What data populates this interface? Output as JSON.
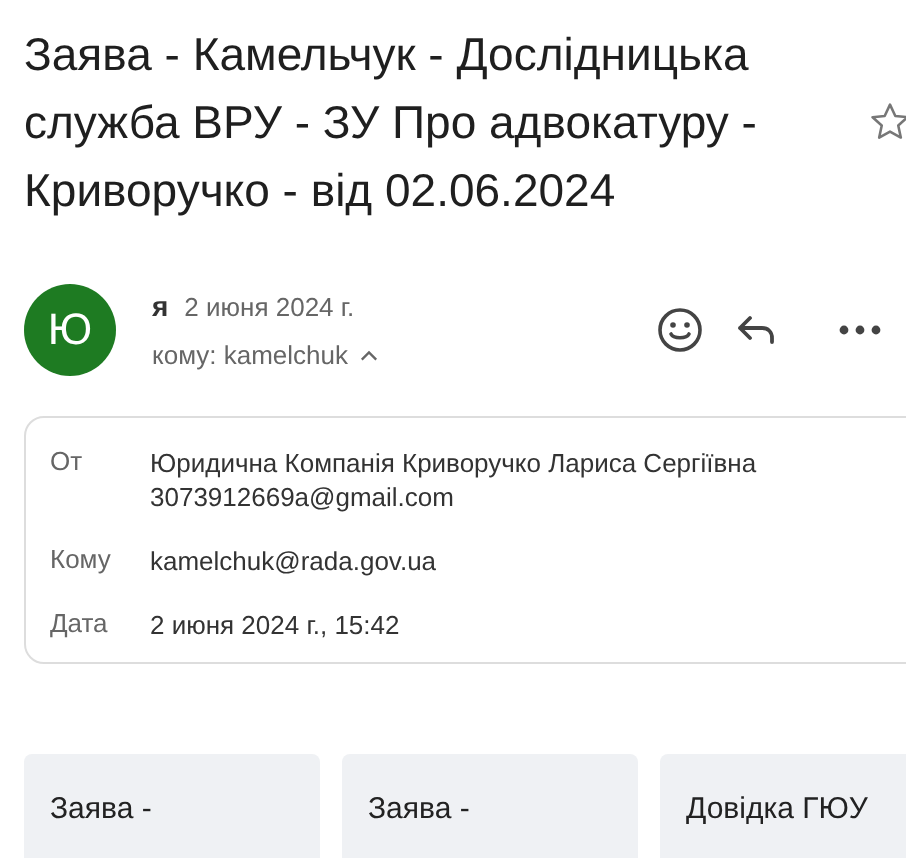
{
  "subject": "Заява - Камельчук - Дослідницька служба ВРУ - ЗУ Про адвокатуру - Криворучко - від 02.06.2024",
  "message": {
    "avatar_letter": "Ю",
    "sender": "я",
    "date": "2 июня 2024 г.",
    "to": "кому: kamelchuk",
    "details_expanded": true
  },
  "details": [
    {
      "label": "От",
      "lines": [
        "Юридична Компанія Криворучко Лариса Сергіївна",
        "3073912669a@gmail.com"
      ]
    },
    {
      "label": "Кому",
      "lines": [
        "kamelchuk@rada.gov.ua"
      ]
    },
    {
      "label": "Дата",
      "lines": [
        "2 июня 2024 г., 15:42"
      ]
    }
  ],
  "attachments": [
    {
      "title": "Заява -"
    },
    {
      "title": "Заява -"
    },
    {
      "title": "Довідка ГЮУ"
    }
  ]
}
